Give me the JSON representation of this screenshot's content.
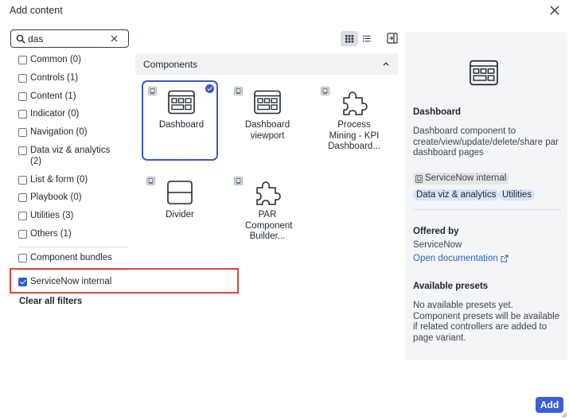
{
  "dialog": {
    "title": "Add content"
  },
  "search": {
    "value": "das",
    "placeholder": ""
  },
  "filters": [
    {
      "label": "Common (0)",
      "checked": false
    },
    {
      "label": "Controls (1)",
      "checked": false
    },
    {
      "label": "Content (1)",
      "checked": false
    },
    {
      "label": "Indicator (0)",
      "checked": false
    },
    {
      "label": "Navigation (0)",
      "checked": false
    },
    {
      "label": "Data viz & analytics (2)",
      "checked": false
    },
    {
      "label": "List & form (0)",
      "checked": false
    },
    {
      "label": "Playbook (0)",
      "checked": false
    },
    {
      "label": "Utilities (3)",
      "checked": false
    },
    {
      "label": "Others (1)",
      "checked": false
    }
  ],
  "component_bundles": {
    "label": "Component bundles",
    "checked": false
  },
  "servicenow_internal": {
    "label": "ServiceNow internal",
    "checked": true
  },
  "clear_all": "Clear all filters",
  "section": {
    "title": "Components"
  },
  "components": [
    {
      "label": "Dashboard",
      "icon": "dashboard-icon",
      "selected": true
    },
    {
      "label": "Dashboard viewport",
      "icon": "dashboard-viewport-icon",
      "selected": false
    },
    {
      "label": "Process Mining - KPI Dashboard...",
      "icon": "puzzle-icon",
      "selected": false
    },
    {
      "label": "Divider",
      "icon": "divider-icon",
      "selected": false
    },
    {
      "label": "PAR Component Builder...",
      "icon": "puzzle-icon",
      "selected": false
    }
  ],
  "detail": {
    "name": "Dashboard",
    "description": "Dashboard component to create/view/update/delete/share par dashboard pages",
    "internal_tag": "ServiceNow internal",
    "categories": [
      "Data viz & analytics",
      "Utilities"
    ],
    "offered_by_heading": "Offered by",
    "offered_by": "ServiceNow",
    "documentation_link": "Open documentation",
    "presets_heading": "Available presets",
    "presets_text": "No available presets yet. Component presets will be available if related controllers are added to page variant."
  },
  "buttons": {
    "add": "Add"
  },
  "colors": {
    "accent": "#3d5ed6",
    "highlight": "#e0433b",
    "pill": "#d6e4f7"
  }
}
